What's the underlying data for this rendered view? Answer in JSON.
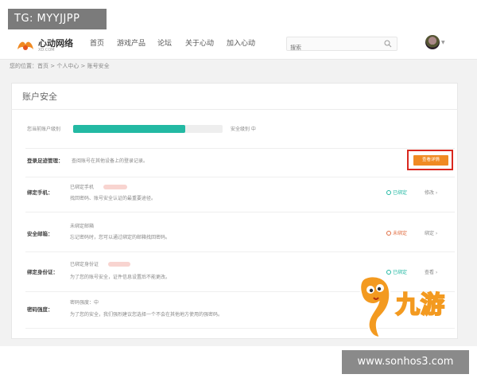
{
  "watermark_top": "TG: MYYJJPP",
  "watermark_bottom": "www.sonhos3.com",
  "header": {
    "logo_text": "心动网络",
    "logo_sub": "XD.COM",
    "nav": [
      "首页",
      "游戏产品",
      "论坛",
      "关于心动",
      "加入心动"
    ],
    "search_placeholder": "搜索"
  },
  "breadcrumb": "您的位置：首页 > 个人中心 > 账号安全",
  "page": {
    "title": "账户安全",
    "security_level_label": "您当前账户级别",
    "security_level_value": 0.75,
    "security_status": "安全级别 中",
    "rows": [
      {
        "label": "登录足迹管理：",
        "desc": "查阅账号在其他设备上的登录记录。",
        "button": "查看详情"
      },
      {
        "label": "绑定手机：",
        "line1": "已绑定手机",
        "line2": "找回密码、账号安全认证的最重要途径。",
        "status": "已绑定",
        "status_kind": "ok",
        "action": "修改"
      },
      {
        "label": "安全邮箱：",
        "line1": "未绑定邮箱",
        "line2": "忘记密码时，您可以通过绑定的邮箱找回密码。",
        "status": "未绑定",
        "status_kind": "warn",
        "action": "绑定"
      },
      {
        "label": "绑定身份证：",
        "line1": "已绑定身份证",
        "line2": "为了您的账号安全，证件信息设置后不能更改。",
        "status": "已绑定",
        "status_kind": "ok",
        "action": "查看"
      },
      {
        "label": "密码强度：",
        "line1": "密码强度：中",
        "line2": "为了您的安全，我们强烈建议您选择一个不会在其他地方使用的强密码。",
        "status": "",
        "status_kind": "",
        "action": ""
      }
    ]
  },
  "brand": "九游",
  "colors": {
    "accent": "#f08a23",
    "progress": "#23b9a3",
    "highlight": "#d9281f"
  }
}
